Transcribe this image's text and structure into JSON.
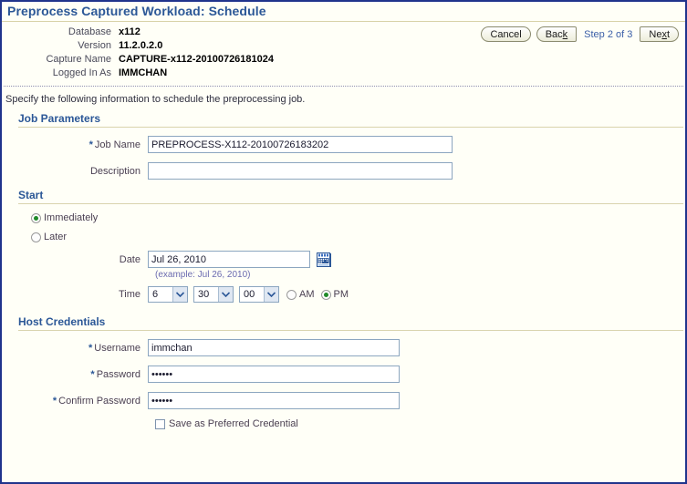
{
  "page": {
    "title": "Preprocess Captured Workload: Schedule",
    "instruction": "Specify the following information to schedule the preprocessing job."
  },
  "header": {
    "rows": [
      {
        "label": "Database",
        "value": "x112"
      },
      {
        "label": "Version",
        "value": "11.2.0.2.0"
      },
      {
        "label": "Capture Name",
        "value": "CAPTURE-x112-20100726181024"
      },
      {
        "label": "Logged In As",
        "value": "IMMCHAN"
      }
    ]
  },
  "wizard": {
    "cancel_label": "Cancel",
    "back_label_pre": "Bac",
    "back_label_key": "k",
    "step_text": "Step 2 of 3",
    "next_label_pre": "Ne",
    "next_label_key": "x",
    "next_label_post": "t"
  },
  "job_parameters": {
    "heading": "Job Parameters",
    "job_name_label": "Job Name",
    "job_name_value": "PREPROCESS-X112-20100726183202",
    "description_label": "Description",
    "description_value": "",
    "description_placeholder": ""
  },
  "start": {
    "heading": "Start",
    "immediately_label": "Immediately",
    "immediately_selected": true,
    "later_label": "Later",
    "later_selected": false,
    "date_label": "Date",
    "date_value": "Jul 26, 2010",
    "date_hint": "(example: Jul 26, 2010)",
    "time_label": "Time",
    "hour_value": "6",
    "minute_value": "30",
    "second_value": "00",
    "am_label": "AM",
    "pm_label": "PM",
    "meridiem_selected": "PM",
    "calendar_icon": "calendar-icon"
  },
  "host_credentials": {
    "heading": "Host Credentials",
    "username_label": "Username",
    "username_value": "immchan",
    "password_label": "Password",
    "password_value": "••••••",
    "confirm_label": "Confirm Password",
    "confirm_value": "••••••",
    "save_pref_label": "Save as Preferred Credential",
    "save_pref_checked": false
  },
  "colors": {
    "border": "#20348c",
    "heading": "#2b5797",
    "link": "#3b5fa8",
    "radio_on": "#1f8a28",
    "rule": "#d9d4ae"
  }
}
